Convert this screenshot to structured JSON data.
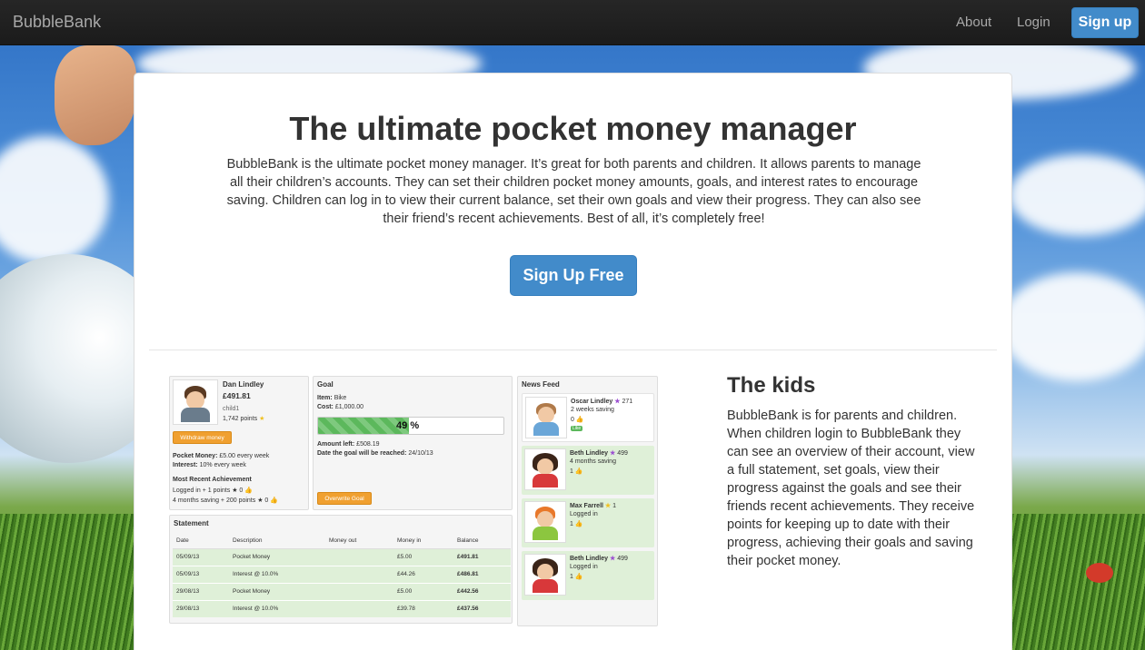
{
  "navbar": {
    "brand": "BubbleBank",
    "about": "About",
    "login": "Login",
    "signup": "Sign up"
  },
  "hero": {
    "title": "The ultimate pocket money manager",
    "text": "BubbleBank is the ultimate pocket money manager. It’s great for both parents and children. It allows parents to manage all their children’s accounts. They can set their children pocket money amounts, goals, and interest rates to encourage saving. Children can log in to view their current balance, set their own goals and view their progress. They can also see their friend’s recent achievements. Best of all, it’s completely free!",
    "button": "Sign Up Free"
  },
  "kids": {
    "title": "The kids",
    "text": "BubbleBank is for parents and children. When children login to BubbleBank they can see an overview of their account, view a full statement, set goals, view their progress against the goals and see their friends recent achievements. They receive points for keeping up to date with their progress, achieving their goals and saving their pocket money."
  },
  "preview": {
    "profile": {
      "name": "Dan Lindley",
      "balance": "£491.81",
      "username": "child1",
      "points": "1,742 points",
      "withdraw": "Withdraw money",
      "pocket_label": "Pocket Money:",
      "pocket_value": "£5.00 every week",
      "interest_label": "Interest:",
      "interest_value": "10% every week",
      "achievement_title": "Most Recent Achievement",
      "ach1": "Logged in + 1 points ★ 0 👍",
      "ach2": "4 months saving + 200 points ★ 0 👍"
    },
    "goal": {
      "title": "Goal",
      "item_label": "Item:",
      "item_value": "Bike",
      "cost_label": "Cost:",
      "cost_value": "£1,000.00",
      "percent": 49,
      "percent_text": "49",
      "percent_sign": "%",
      "amount_left_label": "Amount left:",
      "amount_left_value": "£508.19",
      "date_label": "Date the goal will be reached:",
      "date_value": "24/10/13",
      "overwrite": "Overwrite Goal"
    },
    "statement": {
      "title": "Statement",
      "headers": [
        "Date",
        "Description",
        "Money out",
        "Money in",
        "Balance"
      ],
      "rows": [
        [
          "05/09/13",
          "Pocket Money",
          "",
          "£5.00",
          "£491.81"
        ],
        [
          "05/09/13",
          "Interest @ 10.0%",
          "",
          "£44.26",
          "£486.81"
        ],
        [
          "29/08/13",
          "Pocket Money",
          "",
          "£5.00",
          "£442.56"
        ],
        [
          "29/08/13",
          "Interest @ 10.0%",
          "",
          "£39.78",
          "£437.56"
        ]
      ]
    },
    "feed": {
      "title": "News Feed",
      "items": [
        {
          "name": "Oscar Lindley",
          "score": "271",
          "line1": "2 weeks saving",
          "line2": "0 👍",
          "like": "Like"
        },
        {
          "name": "Beth Lindley",
          "score": "499",
          "line1": "4 months saving",
          "line2": "1 👍"
        },
        {
          "name": "Max Farrell",
          "score": "1",
          "line1": "Logged in",
          "line2": "1 👍"
        },
        {
          "name": "Beth Lindley",
          "score": "499",
          "line1": "Logged in",
          "line2": "1 👍"
        }
      ]
    }
  },
  "colors": {
    "primary": "#428bca",
    "navbar": "#222222",
    "success_bg": "#dff0d8",
    "warning": "#f0a030"
  }
}
